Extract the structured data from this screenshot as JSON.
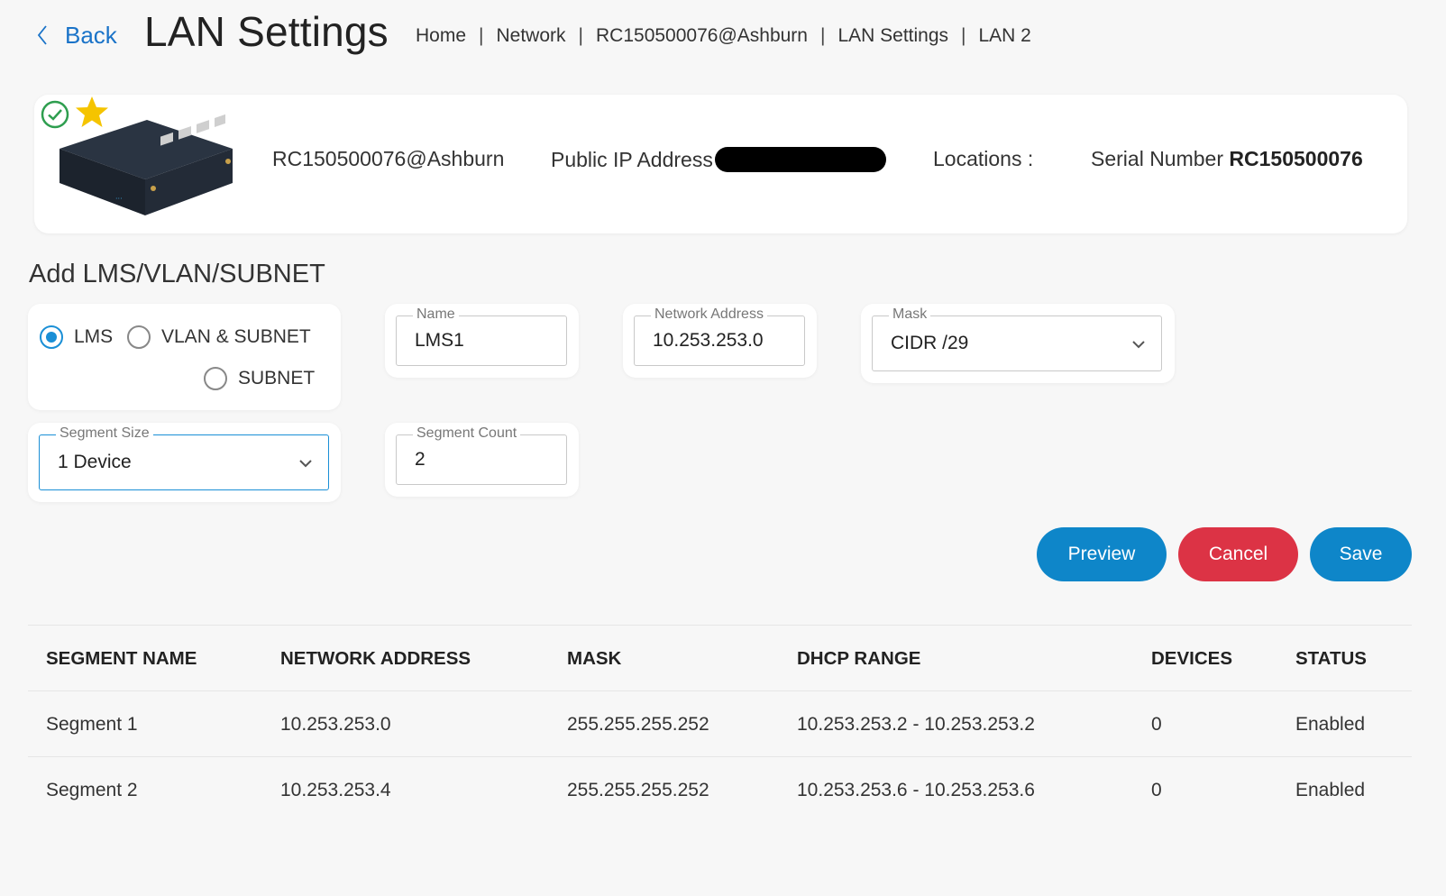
{
  "header": {
    "back_label": "Back",
    "title": "LAN Settings",
    "breadcrumbs": [
      "Home",
      "Network",
      "RC150500076@Ashburn",
      "LAN Settings",
      "LAN 2"
    ],
    "separator": "|"
  },
  "device": {
    "name": "RC150500076@Ashburn",
    "public_ip_label": "Public IP Address",
    "locations_label": "Locations :",
    "serial_label": "Serial Number",
    "serial_value": "RC150500076",
    "status_icon": "check-circle-icon",
    "favorite_icon": "star-icon"
  },
  "form": {
    "section_title": "Add LMS/VLAN/SUBNET",
    "radios": [
      {
        "label": "LMS",
        "checked": true
      },
      {
        "label": "VLAN & SUBNET",
        "checked": false
      },
      {
        "label": "SUBNET",
        "checked": false
      }
    ],
    "name": {
      "label": "Name",
      "value": "LMS1"
    },
    "network_address": {
      "label": "Network Address",
      "value": "10.253.253.0"
    },
    "mask": {
      "label": "Mask",
      "value": "CIDR /29"
    },
    "segment_size": {
      "label": "Segment Size",
      "value": "1 Device"
    },
    "segment_count": {
      "label": "Segment Count",
      "value": "2"
    }
  },
  "actions": {
    "preview": "Preview",
    "cancel": "Cancel",
    "save": "Save"
  },
  "table": {
    "columns": [
      "SEGMENT NAME",
      "NETWORK ADDRESS",
      "MASK",
      "DHCP RANGE",
      "DEVICES",
      "STATUS"
    ],
    "rows": [
      [
        "Segment 1",
        "10.253.253.0",
        "255.255.255.252",
        "10.253.253.2 - 10.253.253.2",
        "0",
        "Enabled"
      ],
      [
        "Segment 2",
        "10.253.253.4",
        "255.255.255.252",
        "10.253.253.6 - 10.253.253.6",
        "0",
        "Enabled"
      ]
    ]
  },
  "colors": {
    "primary": "#0e86c9",
    "danger": "#dc3345",
    "success": "#2e9e4f",
    "star": "#f5c400",
    "link": "#1a73c8"
  }
}
